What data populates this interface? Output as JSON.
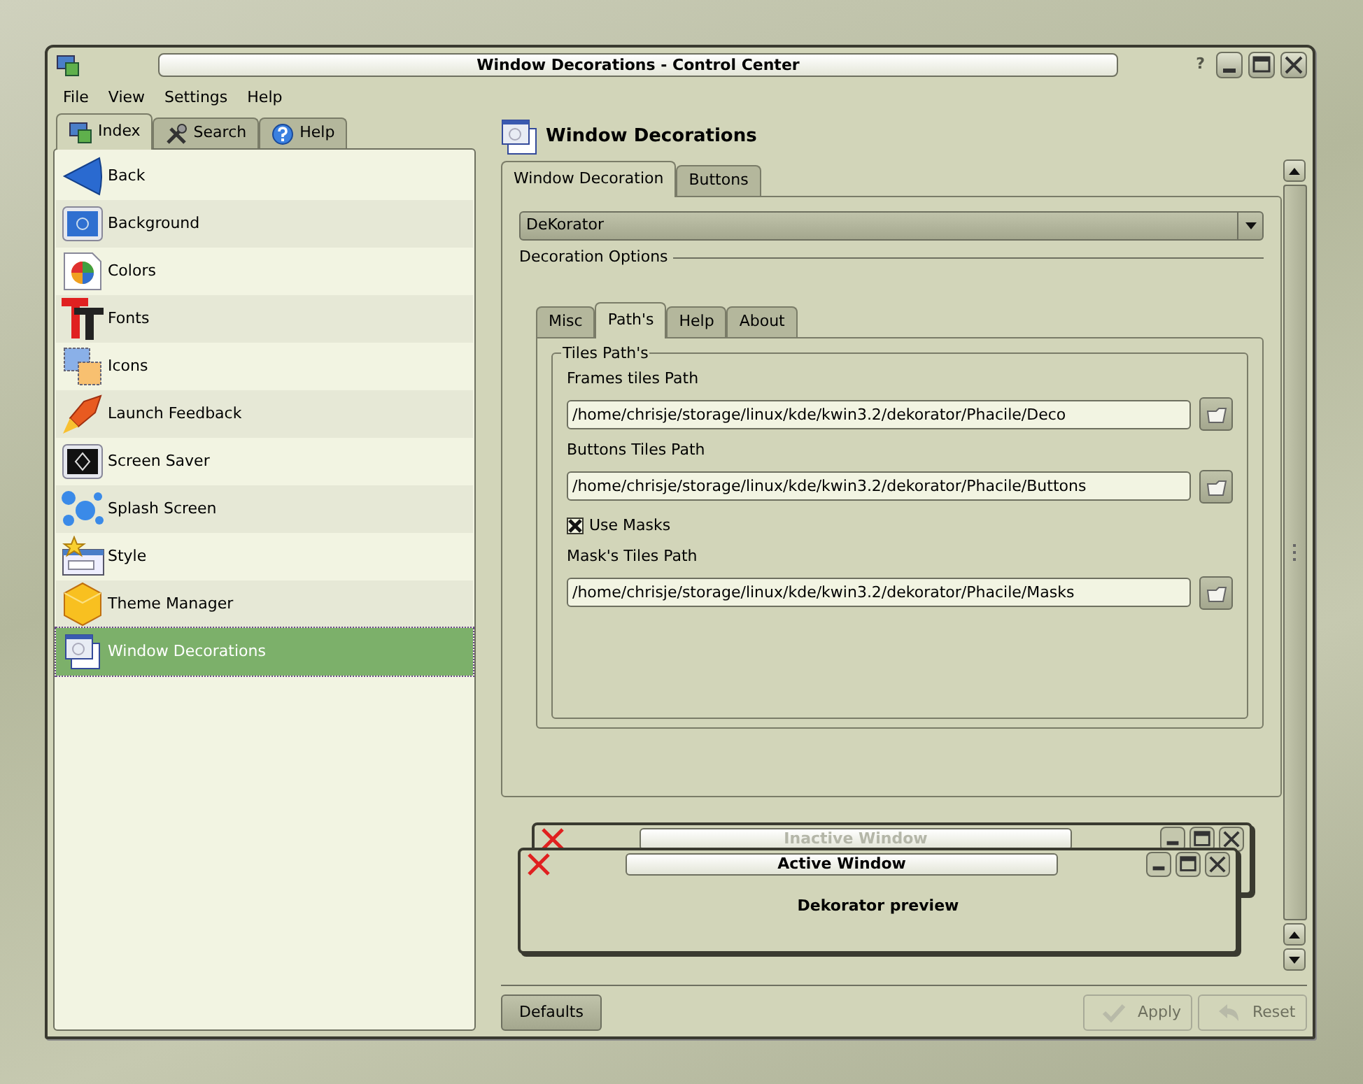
{
  "window": {
    "title": "Window Decorations - Control Center",
    "help_glyph": "?"
  },
  "menu": [
    {
      "label": "File"
    },
    {
      "label": "View"
    },
    {
      "label": "Settings"
    },
    {
      "label": "Help"
    }
  ],
  "sidebar": {
    "tabs": [
      {
        "label": "Index",
        "selected": true
      },
      {
        "label": "Search",
        "selected": false
      },
      {
        "label": "Help",
        "selected": false
      }
    ],
    "items": [
      {
        "label": "Back",
        "selected": false
      },
      {
        "label": "Background",
        "selected": false
      },
      {
        "label": "Colors",
        "selected": false
      },
      {
        "label": "Fonts",
        "selected": false
      },
      {
        "label": "Icons",
        "selected": false
      },
      {
        "label": "Launch Feedback",
        "selected": false
      },
      {
        "label": "Screen Saver",
        "selected": false
      },
      {
        "label": "Splash Screen",
        "selected": false
      },
      {
        "label": "Style",
        "selected": false
      },
      {
        "label": "Theme Manager",
        "selected": false
      },
      {
        "label": "Window Decorations",
        "selected": true
      }
    ]
  },
  "module": {
    "title": "Window Decorations",
    "tabs": [
      {
        "label": "Window Decoration",
        "selected": true
      },
      {
        "label": "Buttons",
        "selected": false
      }
    ],
    "decoration": {
      "value": "DeKorator"
    },
    "options_label": "Decoration Options",
    "subtabs": [
      {
        "label": "Misc",
        "selected": false
      },
      {
        "label": "Path's",
        "selected": true
      },
      {
        "label": "Help",
        "selected": false
      },
      {
        "label": "About",
        "selected": false
      }
    ],
    "group": {
      "title": "Tiles Path's",
      "fields": [
        {
          "kind": "path",
          "label": "Frames tiles Path",
          "value": "/home/chrisje/storage/linux/kde/kwin3.2/dekorator/Phacile/Deco"
        },
        {
          "kind": "path",
          "label": "Buttons Tiles Path",
          "value": "/home/chrisje/storage/linux/kde/kwin3.2/dekorator/Phacile/Buttons"
        },
        {
          "kind": "checkbox",
          "label": "Use Masks",
          "checked": true
        },
        {
          "kind": "path",
          "label": "Mask's Tiles Path",
          "value": "/home/chrisje/storage/linux/kde/kwin3.2/dekorator/Phacile/Masks"
        }
      ]
    }
  },
  "preview": {
    "inactive_title": "Inactive Window",
    "active_title": "Active Window",
    "text": "Dekorator preview"
  },
  "buttons": [
    {
      "label": "Defaults",
      "disabled": false
    },
    {
      "label": "Apply",
      "disabled": true
    },
    {
      "label": "Reset",
      "disabled": true
    }
  ]
}
